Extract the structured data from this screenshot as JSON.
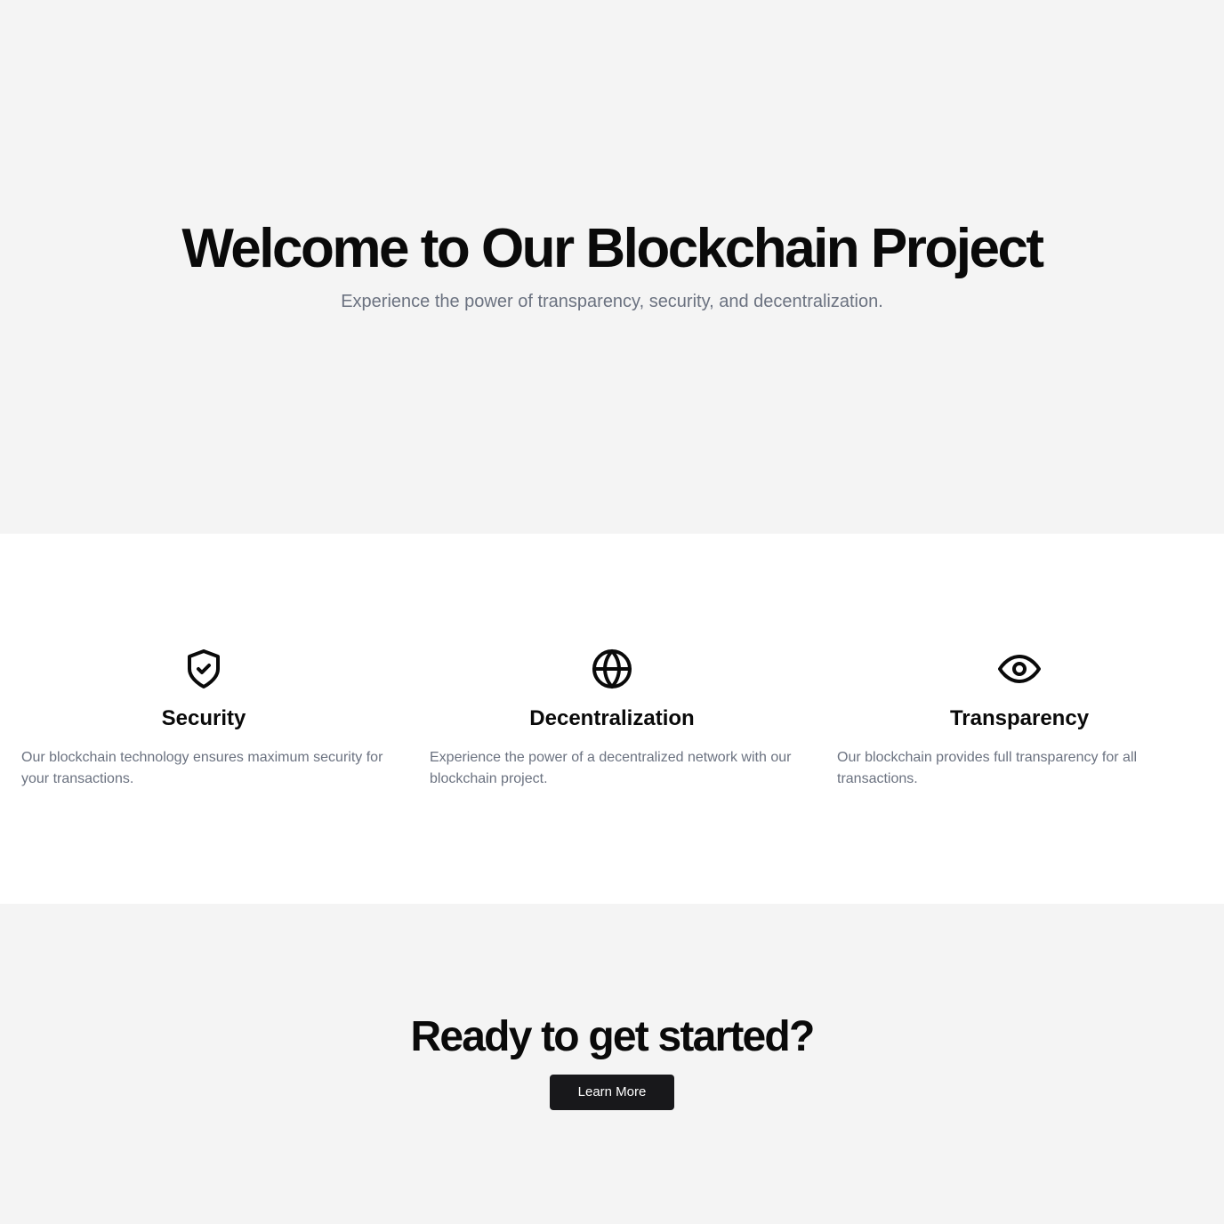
{
  "hero": {
    "title": "Welcome to Our Blockchain Project",
    "subtitle": "Experience the power of transparency, security, and decentralization."
  },
  "features": [
    {
      "icon": "shield-check-icon",
      "title": "Security",
      "description": "Our blockchain technology ensures maximum security for your transactions."
    },
    {
      "icon": "globe-icon",
      "title": "Decentralization",
      "description": "Experience the power of a decentralized network with our blockchain project."
    },
    {
      "icon": "eye-icon",
      "title": "Transparency",
      "description": "Our blockchain provides full transparency for all transactions."
    }
  ],
  "cta": {
    "title": "Ready to get started?",
    "button_label": "Learn More"
  },
  "colors": {
    "background": "#f4f4f4",
    "section_background": "#ffffff",
    "heading": "#0a0a0a",
    "muted_text": "#6b7280",
    "button": "#18181b"
  }
}
